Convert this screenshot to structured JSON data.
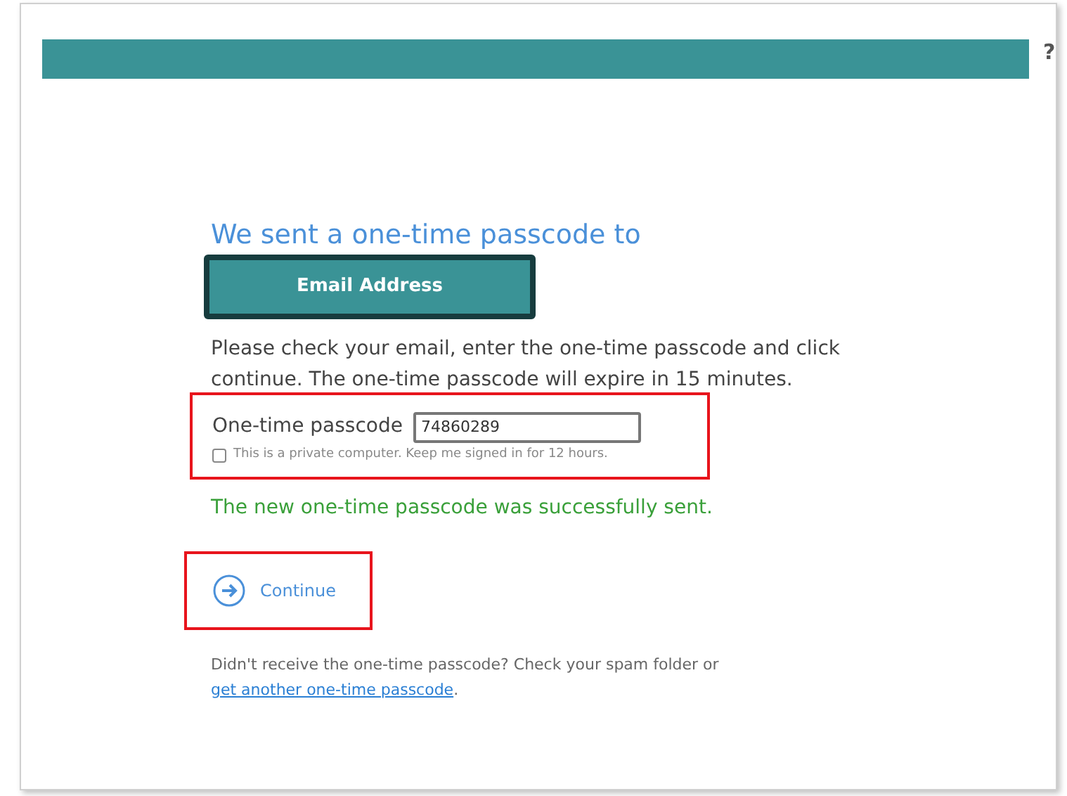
{
  "help": "?",
  "heading": "We sent a one-time passcode to",
  "email_label": "Email Address",
  "instructions": "Please check your email, enter the one-time passcode and click continue. The one-time passcode will expire in 15 minutes.",
  "passcode": {
    "label": "One-time passcode",
    "value": "74860289",
    "highlighted": true
  },
  "remember": {
    "label": "This is a private computer. Keep me signed in for 12 hours.",
    "checked": false
  },
  "success_message": "The new one-time passcode was successfully sent.",
  "continue": {
    "label": "Continue",
    "highlighted": true
  },
  "footer": {
    "text": "Didn't receive the one-time passcode? Check your spam folder or",
    "link": "get another one-time passcode",
    "end": "."
  }
}
